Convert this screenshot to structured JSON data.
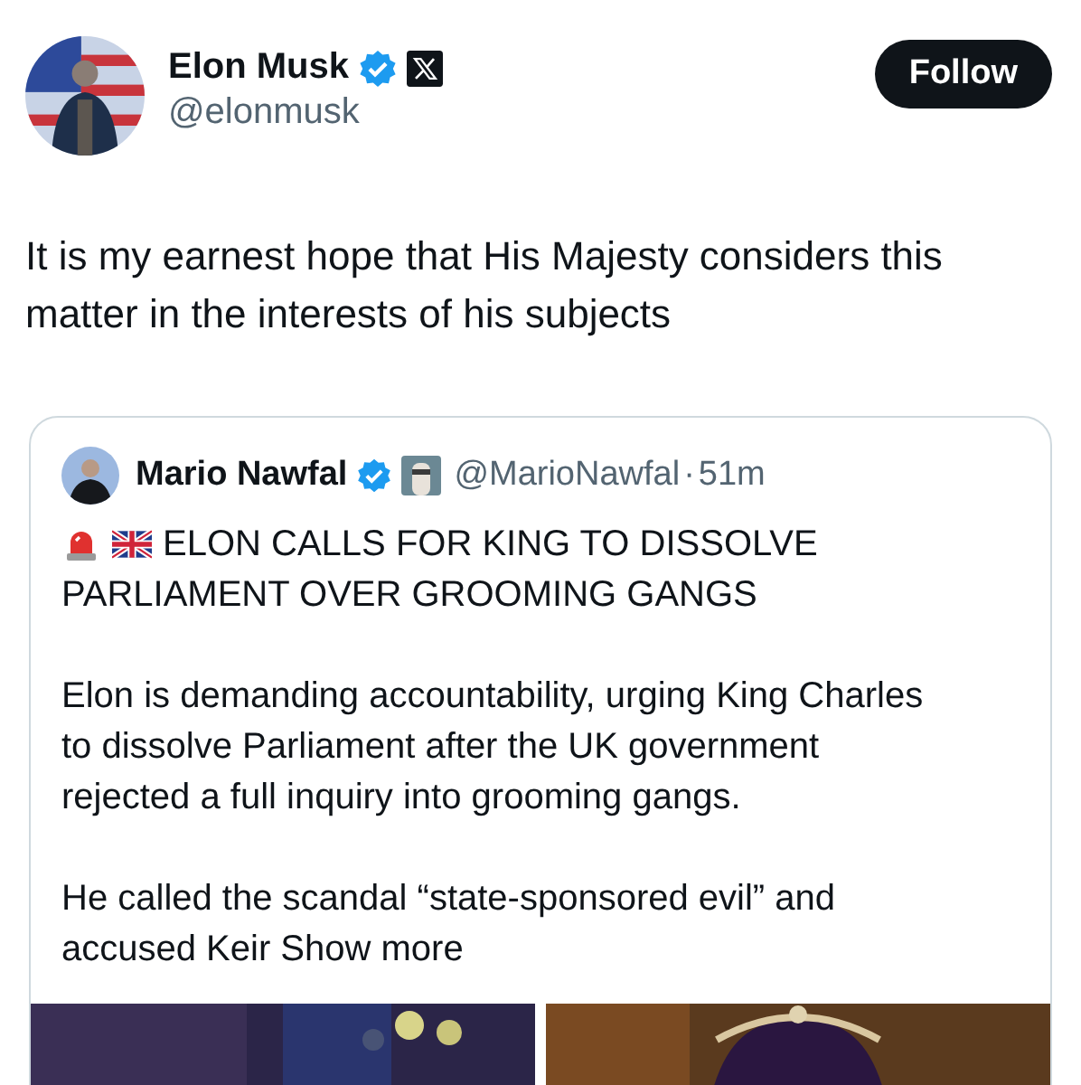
{
  "author": {
    "name": "Elon Musk",
    "handle": "@elonmusk",
    "verified": true,
    "affiliate_badge": true
  },
  "follow_button": "Follow",
  "text": "It is my earnest hope that His Majesty considers this matter in the interests of his subjects",
  "quoted": {
    "author": {
      "name": "Mario Nawfal",
      "handle": "@MarioNawfal",
      "verified": true,
      "affiliate_badge": true
    },
    "separator": "·",
    "time": "51m",
    "headline_lines": [
      "ELON CALLS FOR KING TO DISSOLVE",
      "PARLIAMENT OVER GROOMING GANGS"
    ],
    "paragraphs": [
      "Elon is demanding accountability, urging King Charles to dissolve Parliament after the UK government rejected a full inquiry into grooming gangs.",
      "He called the scandal “state-sponsored evil” and accused Keir"
    ],
    "show_more": "Show more"
  }
}
